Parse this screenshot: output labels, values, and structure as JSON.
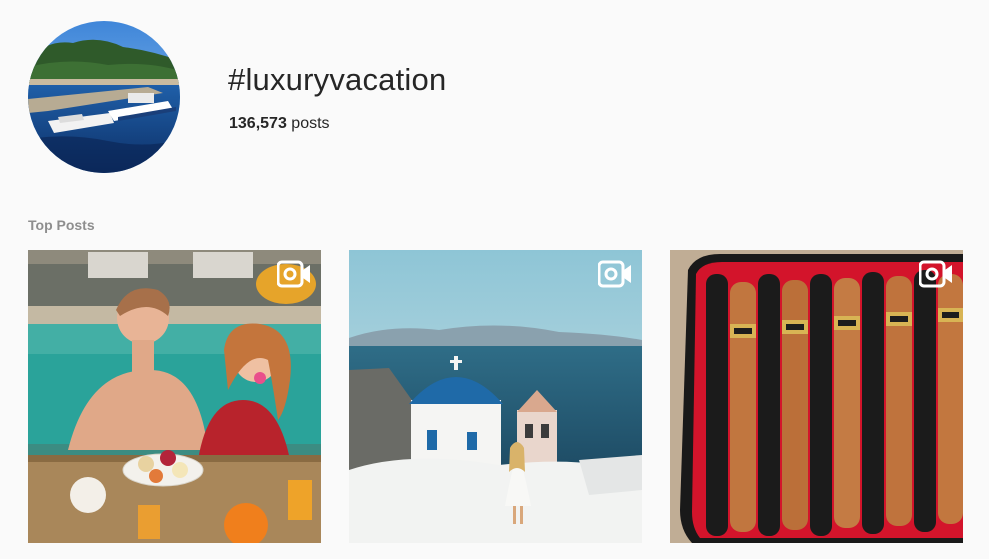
{
  "header": {
    "hashtag": "#luxuryvacation",
    "post_count": "136,573",
    "post_count_suffix": " posts"
  },
  "top_posts": {
    "label": "Top Posts",
    "posts": [
      {
        "type": "video",
        "icon": "video-camera-icon",
        "subject": "couple-pool-breakfast"
      },
      {
        "type": "video",
        "icon": "video-camera-icon",
        "subject": "santorini-blue-dome"
      },
      {
        "type": "video",
        "icon": "video-camera-icon",
        "subject": "cigar-case"
      }
    ]
  },
  "colors": {
    "background": "#fafafa",
    "text": "#262626",
    "muted": "#8e8e8e"
  }
}
